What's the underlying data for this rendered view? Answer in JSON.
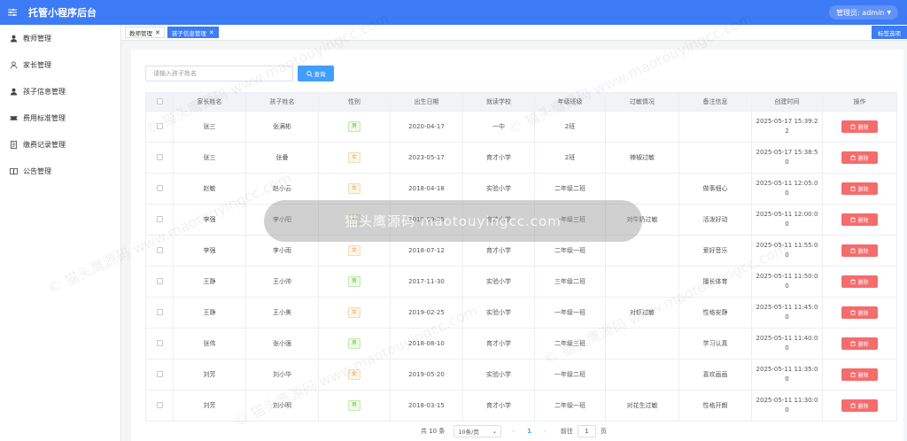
{
  "header": {
    "title": "托管小程序后台",
    "user": "管理员: admin"
  },
  "sidebar": {
    "items": [
      {
        "label": "教师管理",
        "icon": "user-icon"
      },
      {
        "label": "家长管理",
        "icon": "user-outline-icon"
      },
      {
        "label": "孩子信息管理",
        "icon": "user-icon"
      },
      {
        "label": "费用标准管理",
        "icon": "ticket-icon"
      },
      {
        "label": "缴费记录管理",
        "icon": "document-icon"
      },
      {
        "label": "公告管理",
        "icon": "book-icon"
      }
    ]
  },
  "tabs": {
    "items": [
      {
        "label": "教师管理",
        "active": false
      },
      {
        "label": "孩子信息管理",
        "active": true
      }
    ],
    "options_label": "标签选项"
  },
  "search": {
    "placeholder": "请输入孩子姓名",
    "button_label": "查询"
  },
  "table": {
    "columns": [
      "",
      "家长姓名",
      "孩子姓名",
      "性别",
      "出生日期",
      "就读学校",
      "年级班级",
      "过敏情况",
      "备注信息",
      "创建时间",
      "操作"
    ],
    "delete_label": "删除",
    "rows": [
      {
        "parent": "张三",
        "child": "张满彬",
        "gender": "男",
        "birth": "2020-04-17",
        "school": "一中",
        "grade": "2班",
        "allergy": "",
        "note": "",
        "time_line1": "2025-05-17 15:39:2",
        "time_line2": "2"
      },
      {
        "parent": "张三",
        "child": "张叠",
        "gender": "女",
        "birth": "2023-05-17",
        "school": "育才小学",
        "grade": "2班",
        "allergy": "辣椒过敏",
        "note": "",
        "time_line1": "2025-05-17 15:38:5",
        "time_line2": "0"
      },
      {
        "parent": "赵敏",
        "child": "赵小云",
        "gender": "女",
        "birth": "2018-04-18",
        "school": "实验小学",
        "grade": "二年级二班",
        "allergy": "",
        "note": "做事细心",
        "time_line1": "2025-05-11 12:05:0",
        "time_line2": "0"
      },
      {
        "parent": "李强",
        "child": "李小阳",
        "gender": "男",
        "birth": "2019-09-05",
        "school": "育才小学",
        "grade": "一年级三班",
        "allergy": "对牛奶过敏",
        "note": "活泼好动",
        "time_line1": "2025-05-11 12:00:0",
        "time_line2": "0"
      },
      {
        "parent": "李强",
        "child": "李小雨",
        "gender": "女",
        "birth": "2018-07-12",
        "school": "育才小学",
        "grade": "二年级一班",
        "allergy": "",
        "note": "爱好音乐",
        "time_line1": "2025-05-11 11:55:0",
        "time_line2": "0"
      },
      {
        "parent": "王静",
        "child": "王小帅",
        "gender": "男",
        "birth": "2017-11-30",
        "school": "实验小学",
        "grade": "三年级二班",
        "allergy": "",
        "note": "擅长体育",
        "time_line1": "2025-05-11 11:50:0",
        "time_line2": "0"
      },
      {
        "parent": "王静",
        "child": "王小美",
        "gender": "女",
        "birth": "2019-02-25",
        "school": "实验小学",
        "grade": "一年级一班",
        "allergy": "对虾过敏",
        "note": "性格安静",
        "time_line1": "2025-05-11 11:45:0",
        "time_line2": "0"
      },
      {
        "parent": "张伟",
        "child": "张小强",
        "gender": "男",
        "birth": "2018-08-10",
        "school": "育才小学",
        "grade": "二年级三班",
        "allergy": "",
        "note": "学习认真",
        "time_line1": "2025-05-11 11:40:0",
        "time_line2": "0"
      },
      {
        "parent": "刘芳",
        "child": "刘小华",
        "gender": "女",
        "birth": "2019-05-20",
        "school": "实验小学",
        "grade": "一年级二班",
        "allergy": "",
        "note": "喜欢画画",
        "time_line1": "2025-05-11 11:35:0",
        "time_line2": "0"
      },
      {
        "parent": "刘芳",
        "child": "刘小明",
        "gender": "男",
        "birth": "2018-03-15",
        "school": "育才小学",
        "grade": "二年级一班",
        "allergy": "对花生过敏",
        "note": "性格开朗",
        "time_line1": "2025-05-11 11:30:0",
        "time_line2": "0"
      }
    ]
  },
  "pagination": {
    "total": "共 10 条",
    "page_size": "10条/页",
    "current": "1",
    "goto_label": "前往",
    "goto_value": "1",
    "page_suffix": "页"
  },
  "watermark": {
    "text": "猫头鹰源码 maotouyingcc.com",
    "tile": "© 猫头鹰源码 www.maotouyingcc.com"
  },
  "colors": {
    "primary": "#3d7bf7",
    "button": "#409eff",
    "danger": "#f56c6c",
    "male": "#67c23a",
    "female": "#e6a23c"
  }
}
